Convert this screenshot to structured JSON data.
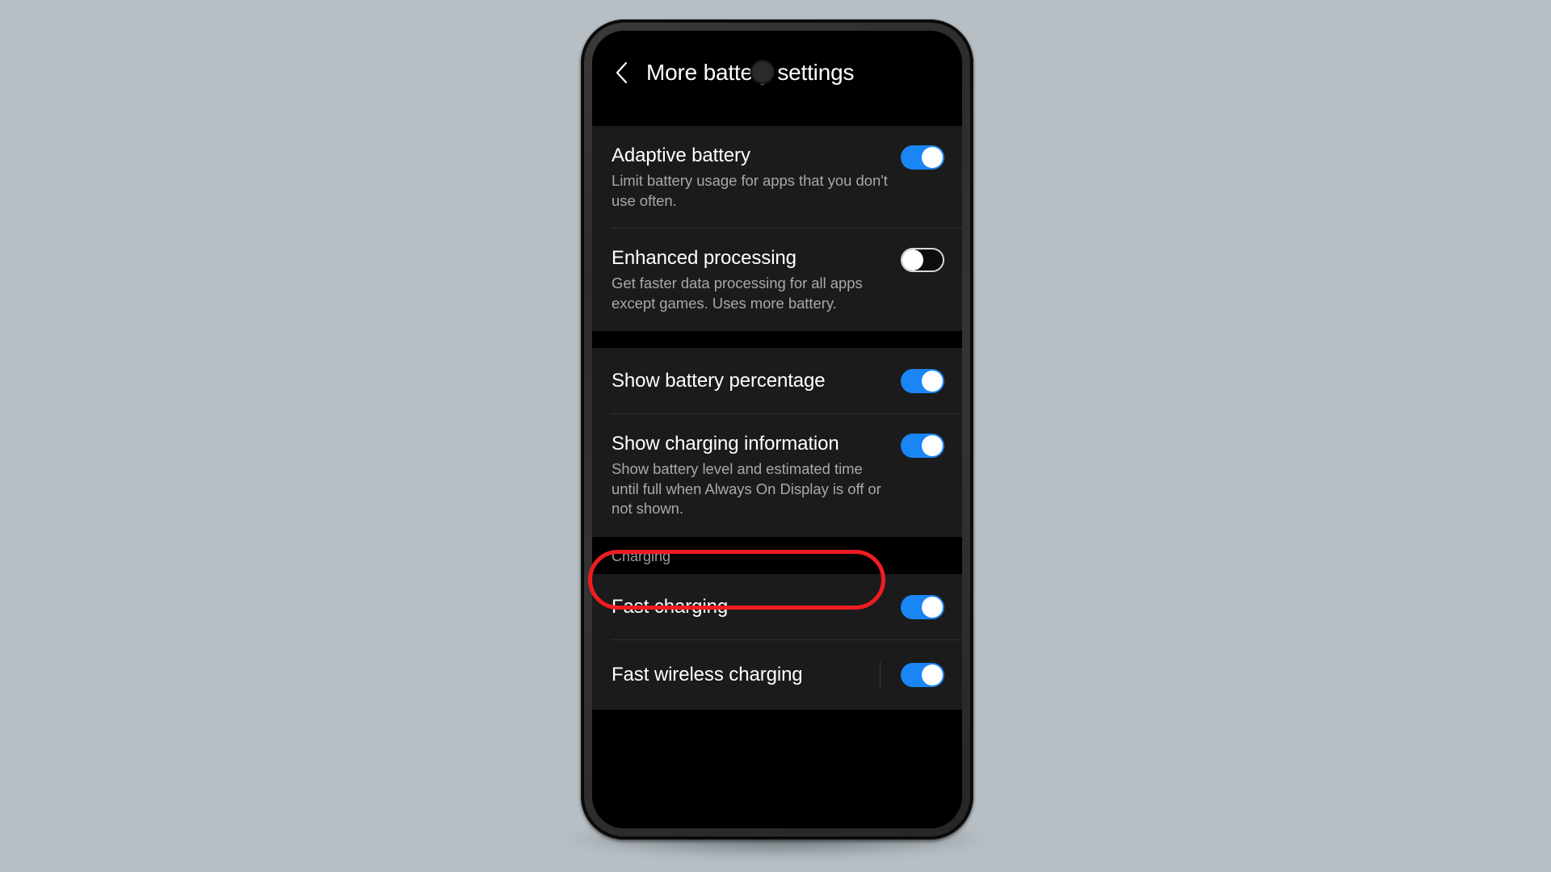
{
  "device": {
    "type": "smartphone",
    "punch_hole_camera": true
  },
  "appbar": {
    "back_icon": "chevron-left-icon",
    "title": "More battery settings"
  },
  "colors": {
    "background": "#b8bfc4",
    "screen_background": "#000000",
    "card_background": "#1b1b1b",
    "toggle_on": "#1a85f5",
    "toggle_knob": "#ffffff",
    "title_text": "#ffffff",
    "subtitle_text": "#a8a8a8",
    "section_label": "#9b9b9b",
    "highlight_ring": "#f01c22",
    "divider": "#2f2f2f"
  },
  "sections": [
    {
      "name": "general",
      "label": null,
      "rows": [
        {
          "id": "adaptive-battery",
          "title": "Adaptive battery",
          "subtitle": "Limit battery usage for apps that you don't use often.",
          "toggle": "on",
          "divider": true
        },
        {
          "id": "enhanced-processing",
          "title": "Enhanced processing",
          "subtitle": "Get faster data processing for all apps except games. Uses more battery.",
          "toggle": "off",
          "divider": false
        }
      ]
    },
    {
      "name": "display",
      "label": null,
      "rows": [
        {
          "id": "show-battery-percentage",
          "title": "Show battery percentage",
          "subtitle": null,
          "toggle": "on",
          "divider": true
        },
        {
          "id": "show-charging-information",
          "title": "Show charging information",
          "subtitle": "Show battery level and estimated time until full when Always On Display is off or not shown.",
          "toggle": "on",
          "divider": false
        }
      ]
    },
    {
      "name": "charging",
      "label": "Charging",
      "rows": [
        {
          "id": "fast-charging",
          "title": "Fast charging",
          "subtitle": null,
          "toggle": "on",
          "divider": true,
          "highlighted": true
        },
        {
          "id": "fast-wireless-charging",
          "title": "Fast wireless charging",
          "subtitle": null,
          "toggle": "on",
          "divider": false,
          "switch_separator": true
        }
      ]
    }
  ],
  "annotation": {
    "type": "highlight-ring",
    "target": "Fast charging",
    "color": "#f01c22"
  }
}
